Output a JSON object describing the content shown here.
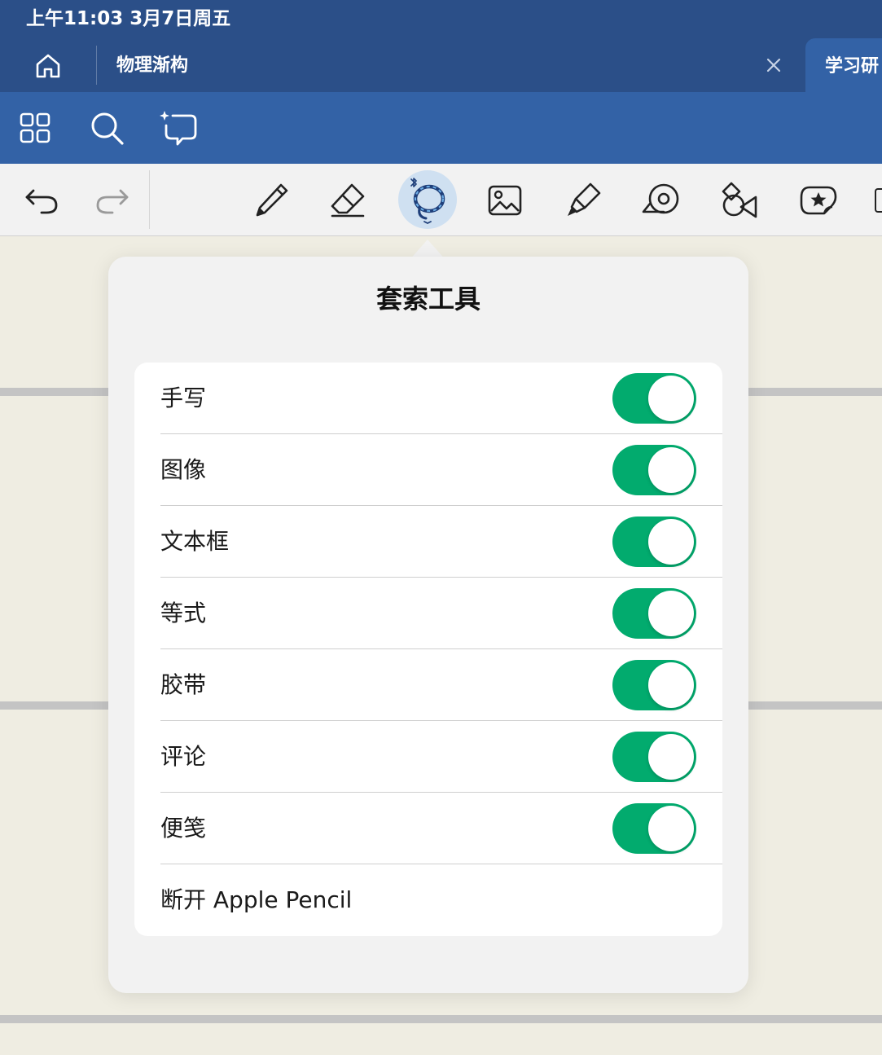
{
  "status_bar": {
    "time_date": "上午11:03   3月7日周五"
  },
  "tabbar": {
    "home_icon": "home-icon",
    "tab_title": "物理渐构",
    "close_icon": "close-icon",
    "active_tab_label": "学习研"
  },
  "toolbar2": {
    "icons": [
      "grid-icon",
      "search-icon",
      "ai-chat-icon"
    ]
  },
  "toolbar3": {
    "icons": [
      "undo-icon",
      "redo-icon",
      "pen-icon",
      "eraser-icon",
      "lasso-icon",
      "image-icon",
      "highlighter-icon",
      "tape-icon",
      "shapes-icon",
      "sticker-icon"
    ],
    "active_tool": "lasso-icon",
    "active_color": "#cfe0f1"
  },
  "popover": {
    "title": "套索工具",
    "rows": [
      {
        "label": "手写",
        "toggle": true
      },
      {
        "label": "图像",
        "toggle": true
      },
      {
        "label": "文本框",
        "toggle": true
      },
      {
        "label": "等式",
        "toggle": true
      },
      {
        "label": "胶带",
        "toggle": true
      },
      {
        "label": "评论",
        "toggle": true
      },
      {
        "label": "便笺",
        "toggle": true
      }
    ],
    "disconnect_label": "断开 Apple Pencil"
  },
  "colors": {
    "header_blue": "#2b4f88",
    "toolbar_blue": "#3362a6",
    "toggle_on": "#02ab6e",
    "page_bg": "#efede2"
  }
}
